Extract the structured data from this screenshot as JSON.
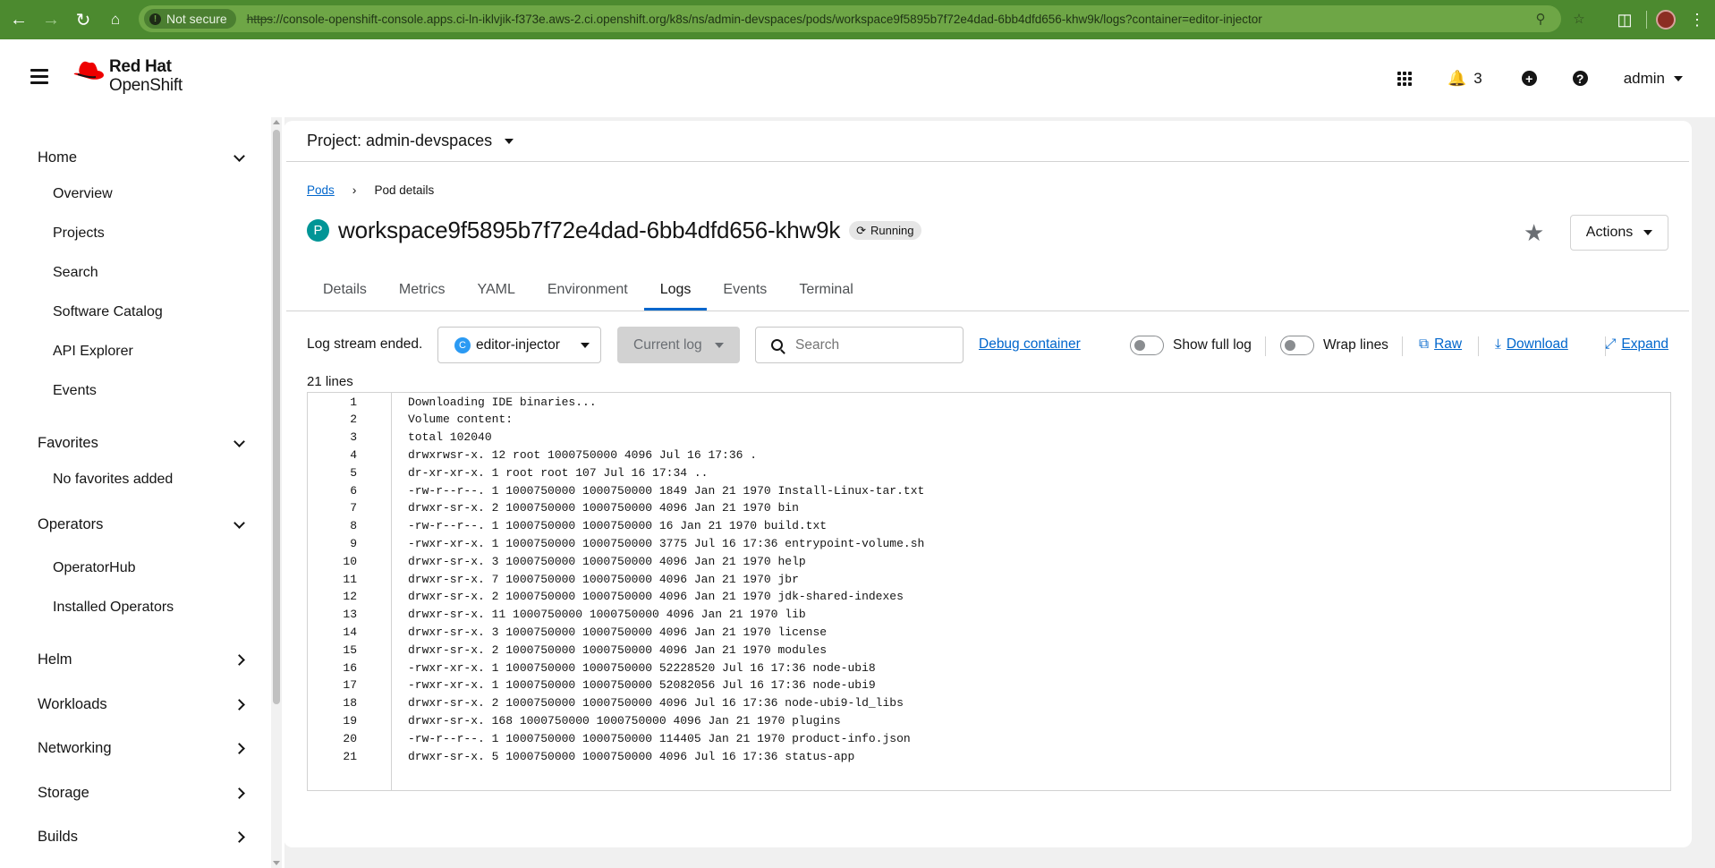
{
  "browser": {
    "security_label": "Not secure",
    "url_scheme": "https",
    "url_rest": "://console-openshift-console.apps.ci-ln-iklvjik-f373e.aws-2.ci.openshift.org/k8s/ns/admin-devspaces/pods/workspace9f5895b7f72e4dad-6bb4dfd656-khw9k/logs?container=editor-injector"
  },
  "masthead": {
    "brand_line1": "Red Hat",
    "brand_line2": "OpenShift",
    "notification_count": "3",
    "user": "admin"
  },
  "sidebar": {
    "home": "Home",
    "home_items": [
      "Overview",
      "Projects",
      "Search",
      "Software Catalog",
      "API Explorer",
      "Events"
    ],
    "favorites": "Favorites",
    "favorites_empty": "No favorites added",
    "operators": "Operators",
    "operators_items": [
      "OperatorHub",
      "Installed Operators"
    ],
    "collapsed_groups": [
      "Helm",
      "Workloads",
      "Networking",
      "Storage",
      "Builds"
    ]
  },
  "project": {
    "label": "Project: admin-devspaces"
  },
  "breadcrumb": {
    "parent": "Pods",
    "current": "Pod details"
  },
  "pod": {
    "badge": "P",
    "name": "workspace9f5895b7f72e4dad-6bb4dfd656-khw9k",
    "status": "Running"
  },
  "actions_label": "Actions",
  "tabs": [
    "Details",
    "Metrics",
    "YAML",
    "Environment",
    "Logs",
    "Events",
    "Terminal"
  ],
  "active_tab": "Logs",
  "log_toolbar": {
    "stream_status": "Log stream ended.",
    "container_badge": "C",
    "container": "editor-injector",
    "log_select": "Current log",
    "search_placeholder": "Search",
    "debug_link": "Debug container",
    "show_full_log": "Show full log",
    "wrap_lines": "Wrap lines",
    "raw": "Raw",
    "download": "Download",
    "expand": "Expand"
  },
  "line_count": "21 lines",
  "log_lines": [
    "Downloading IDE binaries...",
    "Volume content:",
    "total 102040",
    "drwxrwsr-x. 12 root 1000750000 4096 Jul 16 17:36 .",
    "dr-xr-xr-x. 1 root root 107 Jul 16 17:34 ..",
    "-rw-r--r--. 1 1000750000 1000750000 1849 Jan 21 1970 Install-Linux-tar.txt",
    "drwxr-sr-x. 2 1000750000 1000750000 4096 Jan 21 1970 bin",
    "-rw-r--r--. 1 1000750000 1000750000 16 Jan 21 1970 build.txt",
    "-rwxr-xr-x. 1 1000750000 1000750000 3775 Jul 16 17:36 entrypoint-volume.sh",
    "drwxr-sr-x. 3 1000750000 1000750000 4096 Jan 21 1970 help",
    "drwxr-sr-x. 7 1000750000 1000750000 4096 Jan 21 1970 jbr",
    "drwxr-sr-x. 2 1000750000 1000750000 4096 Jan 21 1970 jdk-shared-indexes",
    "drwxr-sr-x. 11 1000750000 1000750000 4096 Jan 21 1970 lib",
    "drwxr-sr-x. 3 1000750000 1000750000 4096 Jan 21 1970 license",
    "drwxr-sr-x. 2 1000750000 1000750000 4096 Jan 21 1970 modules",
    "-rwxr-xr-x. 1 1000750000 1000750000 52228520 Jul 16 17:36 node-ubi8",
    "-rwxr-xr-x. 1 1000750000 1000750000 52082056 Jul 16 17:36 node-ubi9",
    "drwxr-sr-x. 2 1000750000 1000750000 4096 Jul 16 17:36 node-ubi9-ld_libs",
    "drwxr-sr-x. 168 1000750000 1000750000 4096 Jan 21 1970 plugins",
    "-rw-r--r--. 1 1000750000 1000750000 114405 Jan 21 1970 product-info.json",
    "drwxr-sr-x. 5 1000750000 1000750000 4096 Jul 16 17:36 status-app"
  ]
}
